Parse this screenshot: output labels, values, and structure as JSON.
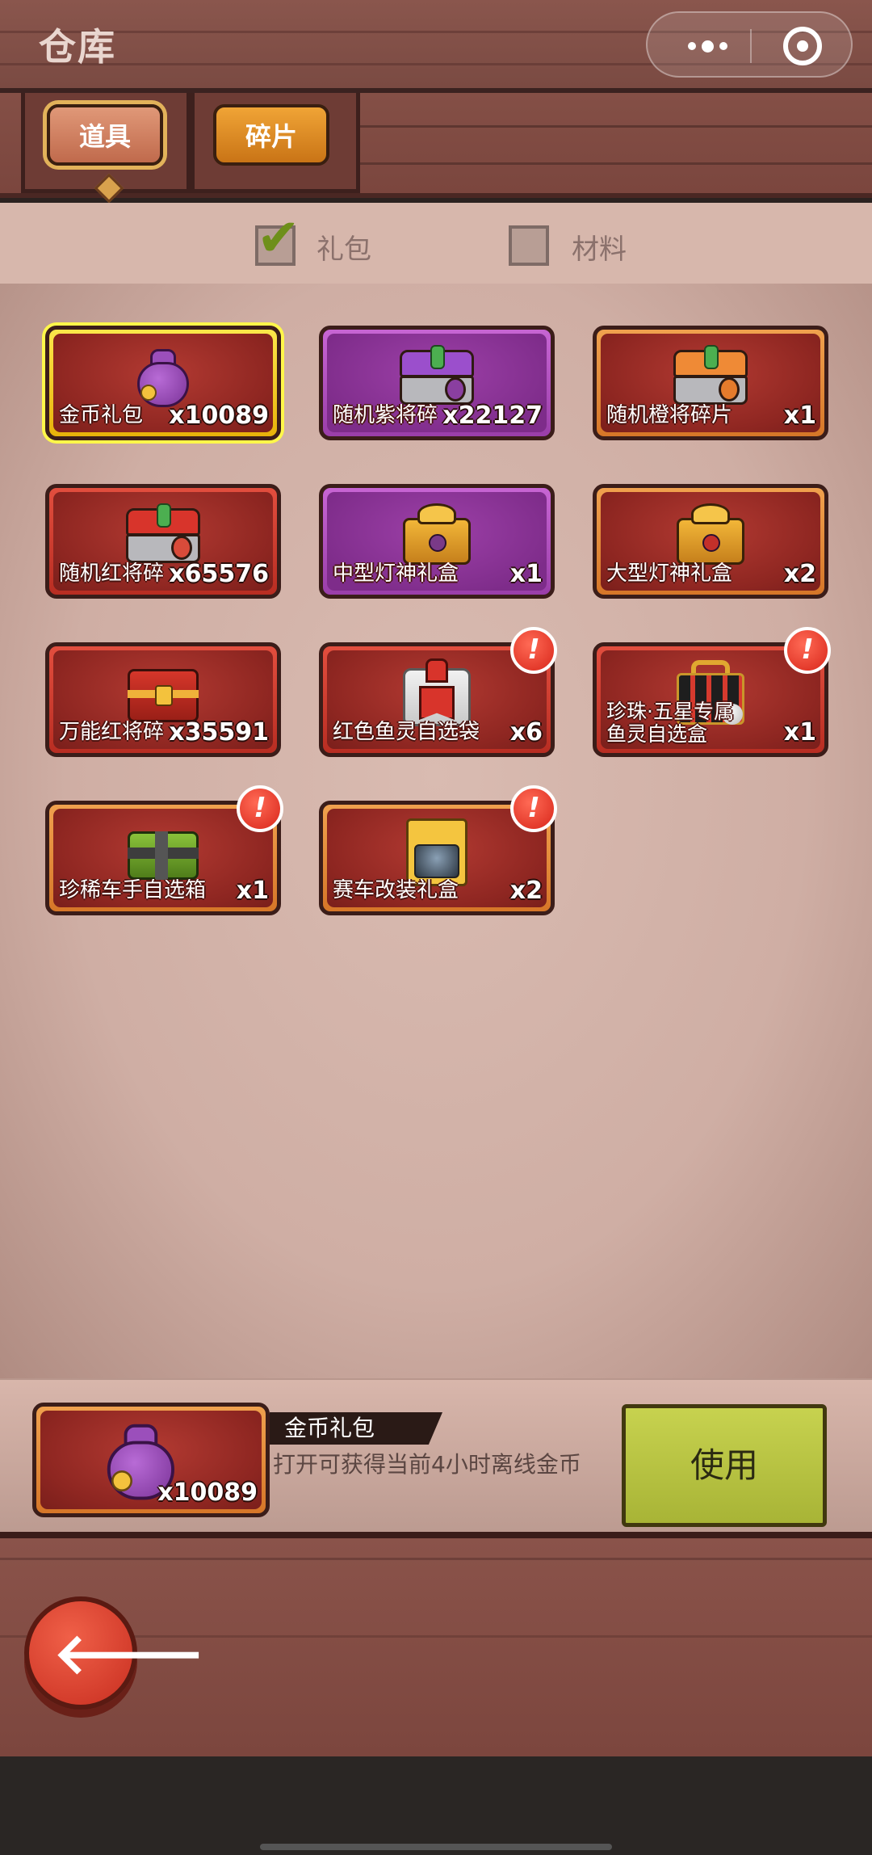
{
  "header": {
    "title": "仓库"
  },
  "tabs": [
    {
      "label": "道具",
      "active": true
    },
    {
      "label": "碎片",
      "active": false
    }
  ],
  "filters": [
    {
      "label": "礼包",
      "checked": true
    },
    {
      "label": "材料",
      "checked": false
    }
  ],
  "items": [
    {
      "name": "金币礼包",
      "count": "x10089",
      "frame": "gold",
      "icon": "coin-bag-icon",
      "selected": true,
      "badge": false
    },
    {
      "name": "随机紫将碎",
      "count": "x22127",
      "frame": "purple",
      "icon": "purple-chest-icon",
      "badge": false
    },
    {
      "name": "随机橙将碎片",
      "count": "x1",
      "frame": "orange",
      "icon": "orange-chest-icon",
      "badge": false
    },
    {
      "name": "随机红将碎",
      "count": "x65576",
      "frame": "red",
      "icon": "red-chest-icon",
      "badge": false
    },
    {
      "name": "中型灯神礼盒",
      "count": "x1",
      "frame": "purple",
      "icon": "lamp-box-icon",
      "badge": false
    },
    {
      "name": "大型灯神礼盒",
      "count": "x2",
      "frame": "orange",
      "icon": "lamp-box-icon",
      "badge": false
    },
    {
      "name": "万能红将碎",
      "count": "x35591",
      "frame": "red",
      "icon": "red-treasure-icon",
      "badge": false
    },
    {
      "name": "红色鱼灵自选袋",
      "count": "x6",
      "frame": "red",
      "icon": "pouch-icon",
      "badge": true,
      "badge_text": "!"
    },
    {
      "name": "珍珠·五星专属鱼灵自选盒",
      "count": "x1",
      "frame": "red",
      "icon": "pearl-box-icon",
      "badge": true,
      "badge_text": "!"
    },
    {
      "name": "珍稀车手自选箱",
      "count": "x1",
      "frame": "orange",
      "icon": "green-box-icon",
      "badge": true,
      "badge_text": "!"
    },
    {
      "name": "赛车改装礼盒",
      "count": "x2",
      "frame": "orange",
      "icon": "car-box-icon",
      "badge": true,
      "badge_text": "!"
    }
  ],
  "detail": {
    "name": "金币礼包",
    "count": "x10089",
    "description": "打开可获得当前4小时离线金币",
    "use_label": "使用"
  },
  "colors": {
    "wood": "#7e4a42",
    "panel": "#d3b2a8",
    "use_button": "#b8c243",
    "badge": "#e53a2a"
  }
}
